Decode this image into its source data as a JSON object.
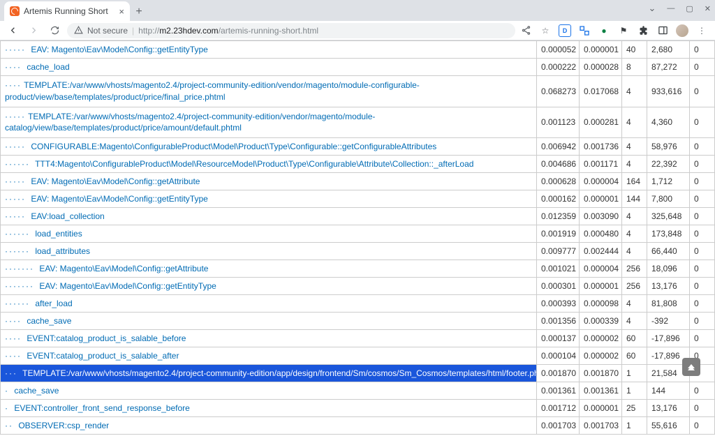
{
  "browser": {
    "tab_title": "Artemis Running Short",
    "url_secure_label": "Not secure",
    "url_protocol": "http://",
    "url_host": "m2.23hdev.com",
    "url_path": "/artemis-running-short.html"
  },
  "rows": [
    {
      "depth": 5,
      "name": "EAV: Magento\\Eav\\Model\\Config::getEntityType",
      "c1": "0.000052",
      "c2": "0.000001",
      "c3": "40",
      "c4": "2,680",
      "c5": "0",
      "wrap": false,
      "hl": false
    },
    {
      "depth": 4,
      "name": "cache_load",
      "c1": "0.000222",
      "c2": "0.000028",
      "c3": "8",
      "c4": "87,272",
      "c5": "0",
      "wrap": false,
      "hl": false
    },
    {
      "depth": 4,
      "name": "TEMPLATE:/var/www/vhosts/magento2.4/project-community-edition/vendor/magento/module-configurable-product/view/base/templates/product/price/final_price.phtml",
      "c1": "0.068273",
      "c2": "0.017068",
      "c3": "4",
      "c4": "933,616",
      "c5": "0",
      "wrap": true,
      "hl": false
    },
    {
      "depth": 5,
      "name": "TEMPLATE:/var/www/vhosts/magento2.4/project-community-edition/vendor/magento/module-catalog/view/base/templates/product/price/amount/default.phtml",
      "c1": "0.001123",
      "c2": "0.000281",
      "c3": "4",
      "c4": "4,360",
      "c5": "0",
      "wrap": true,
      "hl": false
    },
    {
      "depth": 5,
      "name": "CONFIGURABLE:Magento\\ConfigurableProduct\\Model\\Product\\Type\\Configurable::getConfigurableAttributes",
      "c1": "0.006942",
      "c2": "0.001736",
      "c3": "4",
      "c4": "58,976",
      "c5": "0",
      "wrap": false,
      "hl": false
    },
    {
      "depth": 6,
      "name": "TTT4:Magento\\ConfigurableProduct\\Model\\ResourceModel\\Product\\Type\\Configurable\\Attribute\\Collection::_afterLoad",
      "c1": "0.004686",
      "c2": "0.001171",
      "c3": "4",
      "c4": "22,392",
      "c5": "0",
      "wrap": false,
      "hl": false
    },
    {
      "depth": 5,
      "name": "EAV: Magento\\Eav\\Model\\Config::getAttribute",
      "c1": "0.000628",
      "c2": "0.000004",
      "c3": "164",
      "c4": "1,712",
      "c5": "0",
      "wrap": false,
      "hl": false
    },
    {
      "depth": 5,
      "name": "EAV: Magento\\Eav\\Model\\Config::getEntityType",
      "c1": "0.000162",
      "c2": "0.000001",
      "c3": "144",
      "c4": "7,800",
      "c5": "0",
      "wrap": false,
      "hl": false
    },
    {
      "depth": 5,
      "name": "EAV:load_collection",
      "c1": "0.012359",
      "c2": "0.003090",
      "c3": "4",
      "c4": "325,648",
      "c5": "0",
      "wrap": false,
      "hl": false
    },
    {
      "depth": 6,
      "name": "load_entities",
      "c1": "0.001919",
      "c2": "0.000480",
      "c3": "4",
      "c4": "173,848",
      "c5": "0",
      "wrap": false,
      "hl": false
    },
    {
      "depth": 6,
      "name": "load_attributes",
      "c1": "0.009777",
      "c2": "0.002444",
      "c3": "4",
      "c4": "66,440",
      "c5": "0",
      "wrap": false,
      "hl": false
    },
    {
      "depth": 7,
      "name": "EAV: Magento\\Eav\\Model\\Config::getAttribute",
      "c1": "0.001021",
      "c2": "0.000004",
      "c3": "256",
      "c4": "18,096",
      "c5": "0",
      "wrap": false,
      "hl": false
    },
    {
      "depth": 7,
      "name": "EAV: Magento\\Eav\\Model\\Config::getEntityType",
      "c1": "0.000301",
      "c2": "0.000001",
      "c3": "256",
      "c4": "13,176",
      "c5": "0",
      "wrap": false,
      "hl": false
    },
    {
      "depth": 6,
      "name": "after_load",
      "c1": "0.000393",
      "c2": "0.000098",
      "c3": "4",
      "c4": "81,808",
      "c5": "0",
      "wrap": false,
      "hl": false
    },
    {
      "depth": 4,
      "name": "cache_save",
      "c1": "0.001356",
      "c2": "0.000339",
      "c3": "4",
      "c4": "-392",
      "c5": "0",
      "wrap": false,
      "hl": false
    },
    {
      "depth": 4,
      "name": "EVENT:catalog_product_is_salable_before",
      "c1": "0.000137",
      "c2": "0.000002",
      "c3": "60",
      "c4": "-17,896",
      "c5": "0",
      "wrap": false,
      "hl": false
    },
    {
      "depth": 4,
      "name": "EVENT:catalog_product_is_salable_after",
      "c1": "0.000104",
      "c2": "0.000002",
      "c3": "60",
      "c4": "-17,896",
      "c5": "0",
      "wrap": false,
      "hl": false
    },
    {
      "depth": 3,
      "name": "TEMPLATE:/var/www/vhosts/magento2.4/project-community-edition/app/design/frontend/Sm/cosmos/Sm_Cosmos/templates/html/footer.phtml",
      "c1": "0.001870",
      "c2": "0.001870",
      "c3": "1",
      "c4": "21,584",
      "c5": "0",
      "wrap": false,
      "hl": true
    },
    {
      "depth": 1,
      "name": "cache_save",
      "c1": "0.001361",
      "c2": "0.001361",
      "c3": "1",
      "c4": "144",
      "c5": "0",
      "wrap": false,
      "hl": false
    },
    {
      "depth": 1,
      "name": "EVENT:controller_front_send_response_before",
      "c1": "0.001712",
      "c2": "0.000001",
      "c3": "25",
      "c4": "13,176",
      "c5": "0",
      "wrap": false,
      "hl": false
    },
    {
      "depth": 2,
      "name": "OBSERVER:csp_render",
      "c1": "0.001703",
      "c2": "0.001703",
      "c3": "1",
      "c4": "55,616",
      "c5": "0",
      "wrap": false,
      "hl": false
    }
  ]
}
